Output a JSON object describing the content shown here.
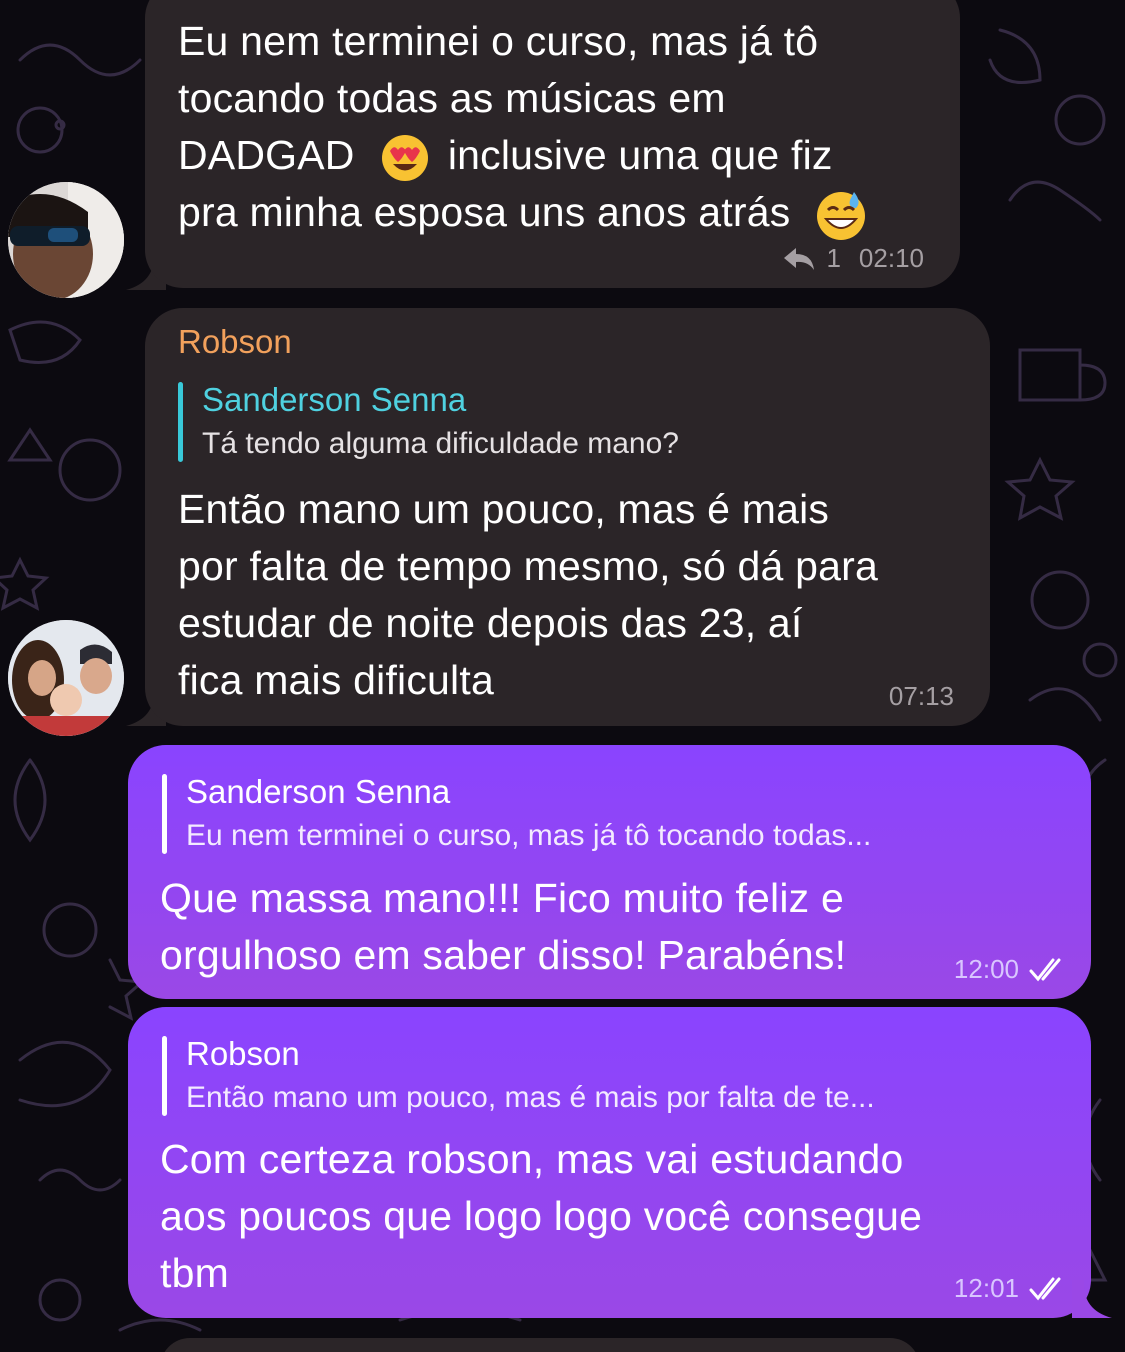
{
  "messages": [
    {
      "direction": "incoming",
      "text_lines": [
        "Eu nem terminei o curso, mas já tô",
        "tocando todas as músicas em"
      ],
      "text_line3_a": "DADGAD",
      "text_line3_b": "inclusive uma que fiz",
      "text_line4": "pra minha esposa uns anos atrás",
      "emoji_1": "heart-eyes",
      "emoji_2": "grinning-sweat",
      "reply_count": "1",
      "time": "02:10"
    },
    {
      "direction": "incoming",
      "sender": "Robson",
      "reply_to_name": "Sanderson Senna",
      "reply_to_text": "Tá tendo alguma dificuldade mano?",
      "text_lines": [
        "Então mano um pouco, mas é mais",
        "por falta de tempo mesmo, só dá para",
        "estudar de noite depois das 23, aí",
        "fica mais dificulta"
      ],
      "time": "07:13"
    },
    {
      "direction": "outgoing",
      "reply_to_name": "Sanderson Senna",
      "reply_to_text": "Eu nem terminei o curso, mas já tô tocando todas...",
      "text_lines": [
        "Que massa mano!!! Fico muito feliz e",
        "orgulhoso em saber disso! Parabéns!"
      ],
      "time": "12:00"
    },
    {
      "direction": "outgoing",
      "reply_to_name": "Robson",
      "reply_to_text": "Então mano um pouco, mas é mais por falta de te...",
      "text_lines": [
        "Com certeza robson, mas vai estudando",
        "aos poucos que logo logo você consegue",
        "tbm"
      ],
      "time": "12:01"
    }
  ],
  "colors": {
    "incoming_bubble": "#2b2528",
    "outgoing_bubble_top": "#8a44ff",
    "outgoing_bubble_bottom": "#9a48e6",
    "sender_name": "#f2a15c",
    "reply_accent": "#39c9d9",
    "background": "#0c0a10"
  }
}
